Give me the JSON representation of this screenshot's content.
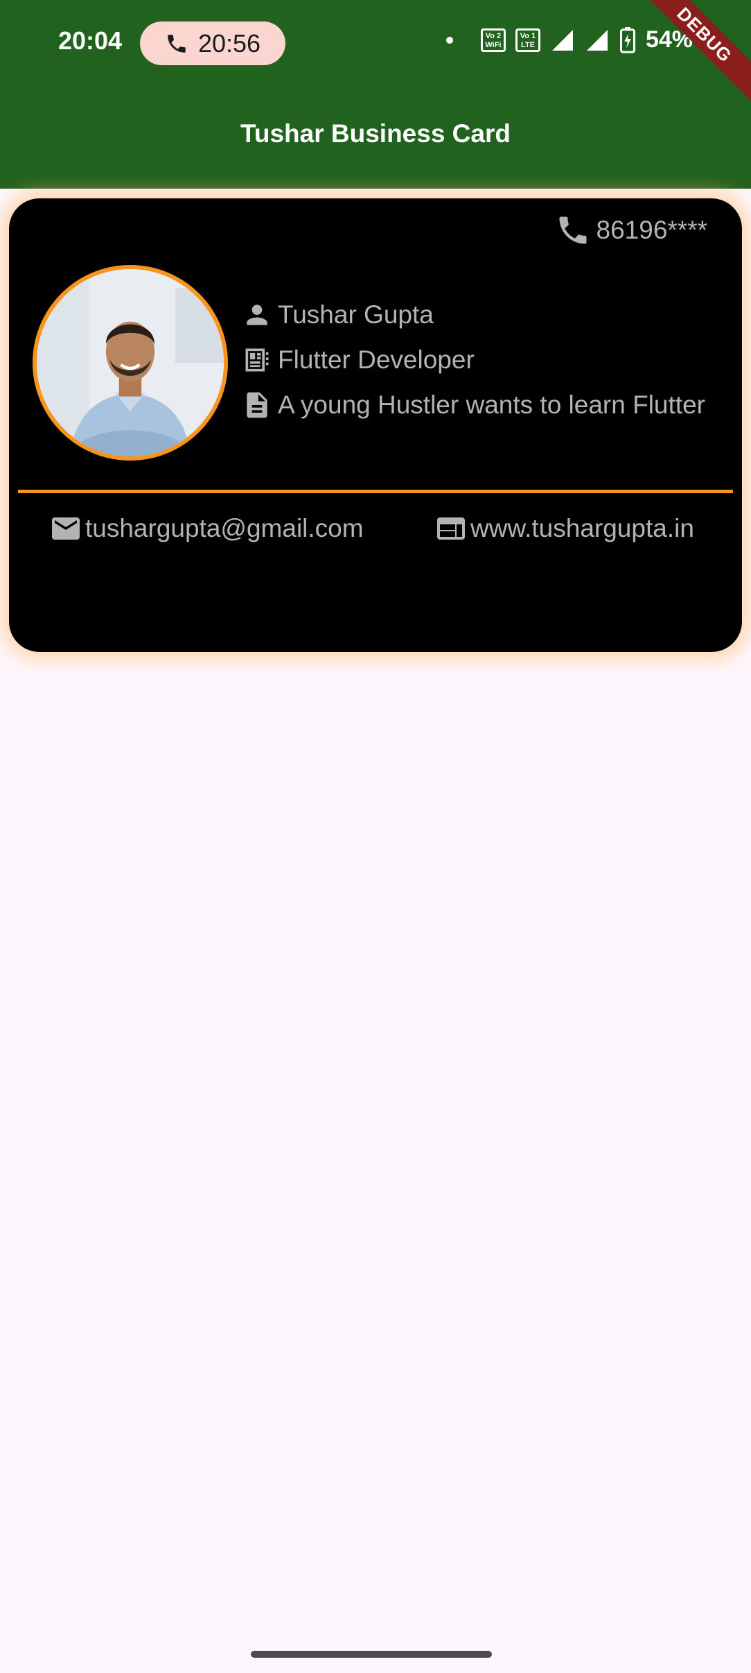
{
  "status_bar": {
    "time": "20:04",
    "call_timer": "20:56",
    "wifi_badge": "Vo 2 WiFi",
    "lte_badge": "Vo 1 LTE",
    "battery": "54%"
  },
  "debug_banner": "DEBUG",
  "app_bar": {
    "title": "Tushar Business Card",
    "color": "#22621f"
  },
  "card": {
    "phone": "86196****",
    "name": "Tushar Gupta",
    "role": "Flutter Developer",
    "bio": "A young Hustler wants to learn Flutter",
    "email": "tushargupta@gmail.com",
    "website": "www.tushargupta.in",
    "accent_color": "#f7941d",
    "background": "#000000"
  },
  "icons": {
    "call": "phone-icon",
    "person": "person-icon",
    "role": "badge-icon",
    "bio": "document-icon",
    "email": "mail-icon",
    "website": "web-icon"
  }
}
